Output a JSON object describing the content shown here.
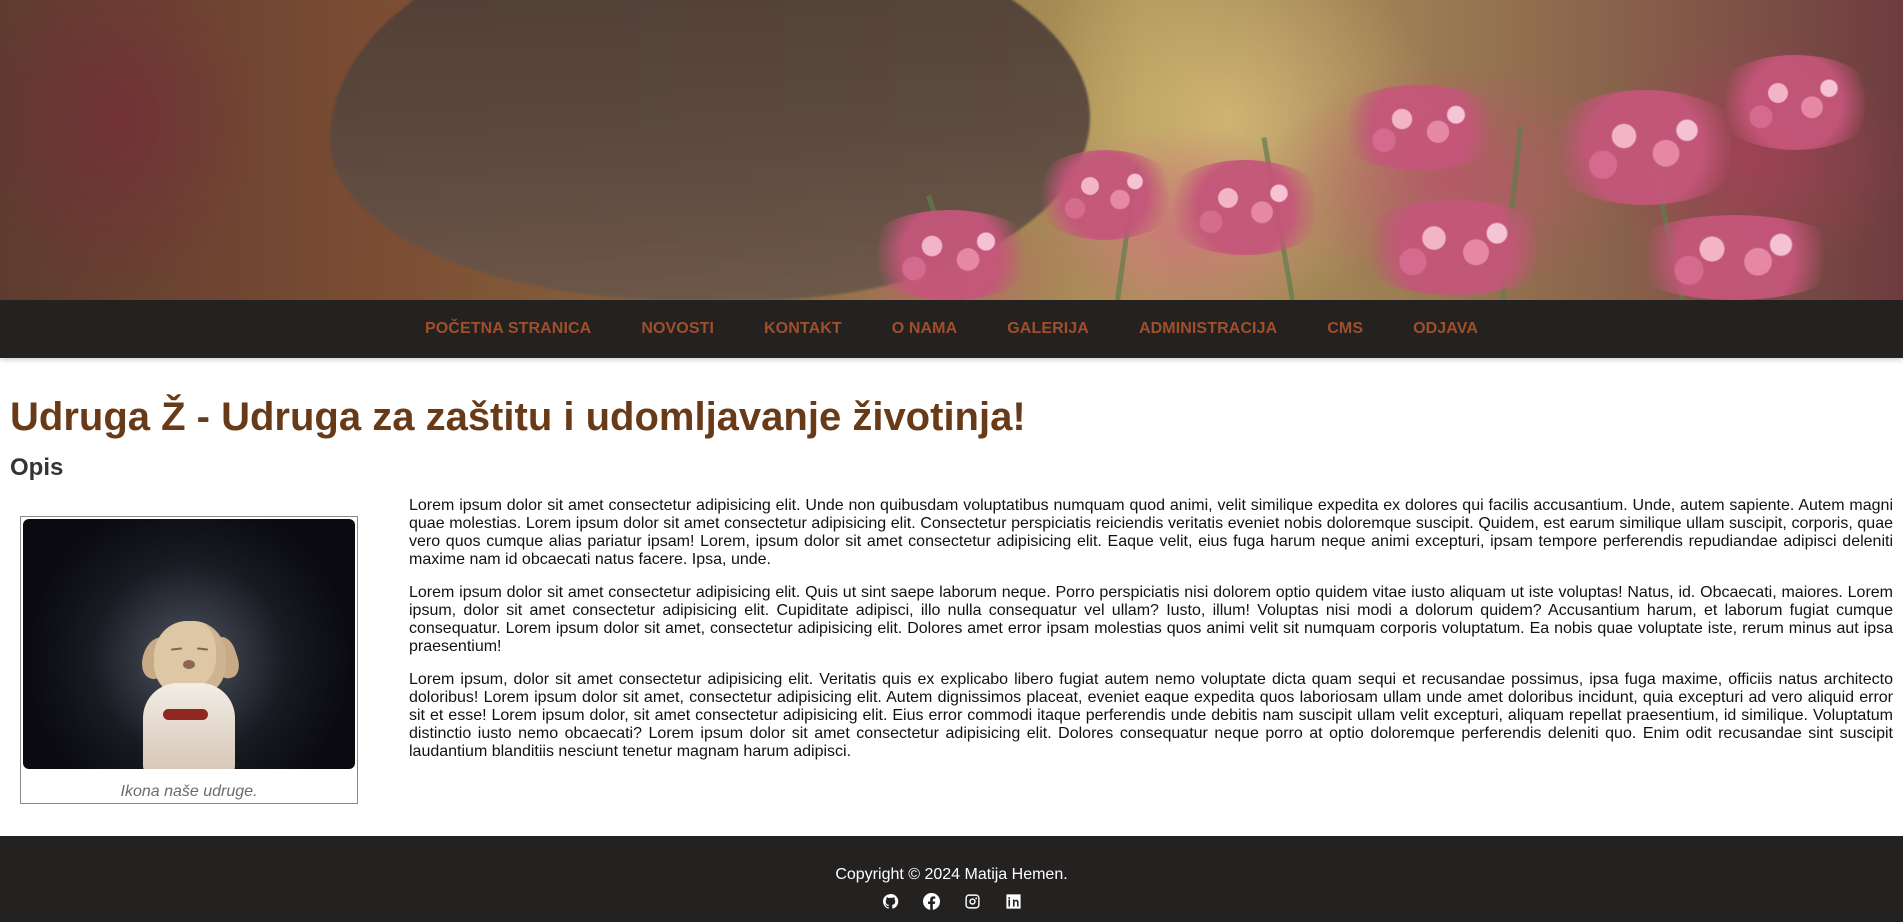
{
  "hero": {
    "image_semantic": "dog-and-flowers-banner"
  },
  "nav": {
    "items": [
      "POČETNA STRANICA",
      "NOVOSTI",
      "KONTAKT",
      "O NAMA",
      "GALERIJA",
      "ADMINISTRACIJA",
      "CMS",
      "ODJAVA"
    ]
  },
  "main": {
    "title": "Udruga Ž - Udruga za zaštitu i udomljavanje životinja!",
    "section_title": "Opis",
    "image_caption": "Ikona naše udruge.",
    "paragraphs": [
      "Lorem ipsum dolor sit amet consectetur adipisicing elit. Unde non quibusdam voluptatibus numquam quod animi, velit similique expedita ex dolores qui facilis accusantium. Unde, autem sapiente. Autem magni quae molestias. Lorem ipsum dolor sit amet consectetur adipisicing elit. Consectetur perspiciatis reiciendis veritatis eveniet nobis doloremque suscipit. Quidem, est earum similique ullam suscipit, corporis, quae vero quos cumque alias pariatur ipsam! Lorem, ipsum dolor sit amet consectetur adipisicing elit. Eaque velit, eius fuga harum neque animi excepturi, ipsam tempore perferendis repudiandae adipisci deleniti maxime nam id obcaecati natus facere. Ipsa, unde.",
      "Lorem ipsum dolor sit amet consectetur adipisicing elit. Quis ut sint saepe laborum neque. Porro perspiciatis nisi dolorem optio quidem vitae iusto aliquam ut iste voluptas! Natus, id. Obcaecati, maiores. Lorem ipsum, dolor sit amet consectetur adipisicing elit. Cupiditate adipisci, illo nulla consequatur vel ullam? Iusto, illum! Voluptas nisi modi a dolorum quidem? Accusantium harum, et laborum fugiat cumque consequatur. Lorem ipsum dolor sit amet, consectetur adipisicing elit. Dolores amet error ipsam molestias quos animi velit sit numquam corporis voluptatum. Ea nobis quae voluptate iste, rerum minus aut ipsa praesentium!",
      "Lorem ipsum, dolor sit amet consectetur adipisicing elit. Veritatis quis ex explicabo libero fugiat autem nemo voluptate dicta quam sequi et recusandae possimus, ipsa fuga maxime, officiis natus architecto doloribus! Lorem ipsum dolor sit amet, consectetur adipisicing elit. Autem dignissimos placeat, eveniet eaque expedita quos laboriosam ullam unde amet doloribus incidunt, quia excepturi ad vero aliquid error sit et esse! Lorem ipsum dolor, sit amet consectetur adipisicing elit. Eius error commodi itaque perferendis unde debitis nam suscipit ullam velit excepturi, aliquam repellat praesentium, id similique. Voluptatum distinctio iusto nemo obcaecati? Lorem ipsum dolor sit amet consectetur adipisicing elit. Dolores consequatur neque porro at optio doloremque perferendis deleniti quo. Enim odit recusandae sint suscipit laudantium blanditiis nesciunt tenetur magnam harum adipisci."
    ]
  },
  "footer": {
    "copyright": "Copyright © 2024 Matija Hemen.",
    "social_icons": [
      "github-icon",
      "facebook-icon",
      "instagram-icon",
      "linkedin-icon"
    ]
  },
  "colors": {
    "nav_bg": "#242121",
    "nav_link": "#a04f2a",
    "title": "#693a18",
    "footer_bg": "#242121"
  }
}
